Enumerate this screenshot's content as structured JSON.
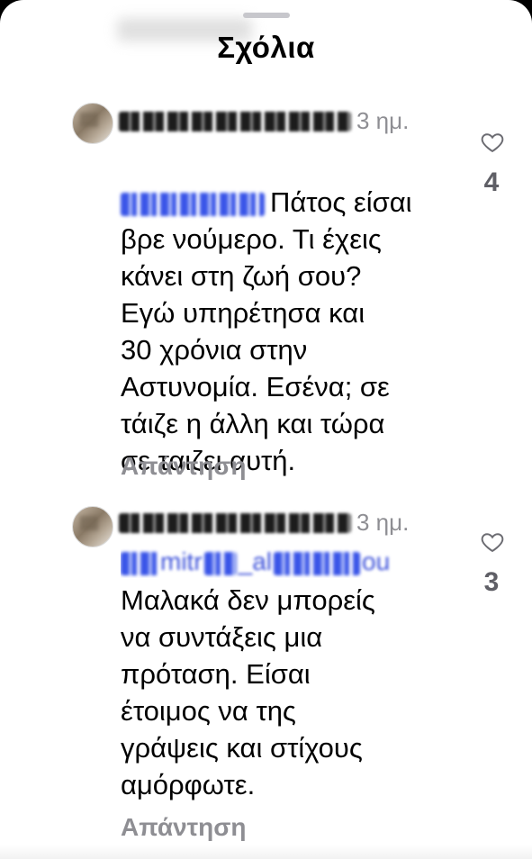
{
  "sheet": {
    "title": "Σχόλια"
  },
  "comments": [
    {
      "username": "",
      "time": "3 ημ.",
      "text": "Πάτος είσαι\nβρε νούμερο. Τι έχεις\nκάνει στη ζωή σου?\nΕγώ υπηρέτησα και\n30 χρόνια στην\nΑστυνομία. Εσένα; σε\nτάιζε η άλλη και τώρα\nσε ταιζει  αυτή.",
      "reply_label": "Απάντηση",
      "likes": "4"
    },
    {
      "username": "",
      "time": "3 ημ.",
      "mention_visible_part": "mitr",
      "mention_visible_part2": "_al",
      "mention_visible_part3": "ou",
      "text": "Μαλακά δεν μπορείς\nνα συντάξεις μια\nπρόταση. Είσαι\nέτοιμος να της\nγράψεις και στίχους\nαμόρφωτε.",
      "reply_label": "Απάντηση",
      "likes": "3"
    }
  ],
  "icons": {
    "like": "heart-outline-icon"
  },
  "colors": {
    "mention": "#3a4fd9",
    "secondary_text": "#8e8e93"
  }
}
